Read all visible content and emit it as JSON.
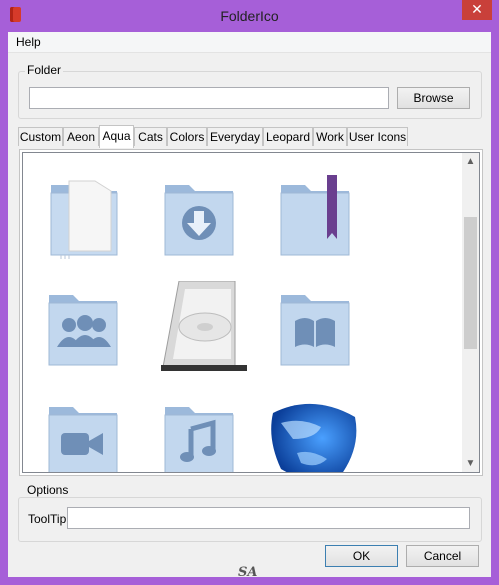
{
  "window": {
    "title": "FolderIco",
    "close_glyph": "✕"
  },
  "menu": {
    "help": "Help"
  },
  "folder_group": {
    "label": "Folder",
    "path_value": "",
    "browse_label": "Browse"
  },
  "tabs": [
    "Custom",
    "Aeon",
    "Aqua",
    "Cats",
    "Colors",
    "Everyday",
    "Leopard",
    "Work",
    "User Icons"
  ],
  "active_tab": "Aqua",
  "icons": [
    {
      "name": "folder-blank-doc-icon"
    },
    {
      "name": "folder-download-icon"
    },
    {
      "name": "folder-bookmark-icon"
    },
    {
      "name": "folder-users-icon"
    },
    {
      "name": "hard-drive-icon"
    },
    {
      "name": "folder-book-icon"
    },
    {
      "name": "folder-video-icon"
    },
    {
      "name": "folder-music-icon"
    },
    {
      "name": "globe-icon"
    }
  ],
  "options_group": {
    "label": "Options",
    "tooltip_label": "ToolTip",
    "tooltip_value": ""
  },
  "buttons": {
    "ok": "OK",
    "cancel": "Cancel"
  },
  "watermark": "SA",
  "colors": {
    "titlebar": "#a65fd8",
    "folder": "#b9d0e9",
    "folder_dark": "#7f9fc3"
  }
}
